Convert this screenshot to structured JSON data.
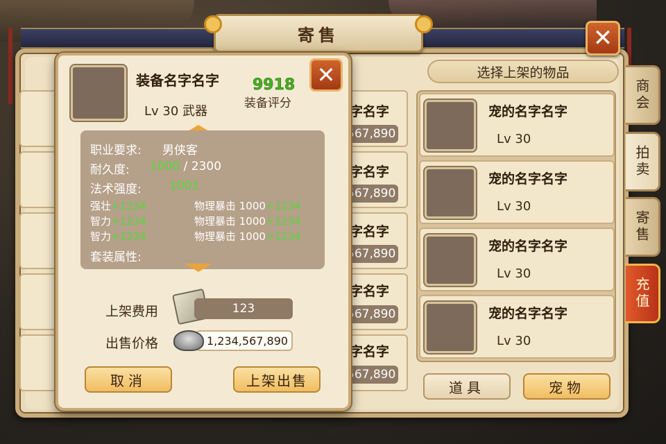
{
  "title": "寄售",
  "close_glyph": "✕",
  "side_tabs": [
    "商会",
    "拍卖",
    "寄售",
    "充值"
  ],
  "select_header": "选择上架的物品",
  "pet_rows": [
    {
      "name": "宠的名字名字",
      "level": "Lv  30"
    },
    {
      "name": "宠的名字名字",
      "level": "Lv  30"
    },
    {
      "name": "宠的名字名字",
      "level": "Lv  30"
    },
    {
      "name": "宠的名字名字",
      "level": "Lv  30"
    }
  ],
  "bottom_tabs": {
    "items": "道具",
    "pets": "宠物"
  },
  "middle_rows": [
    {
      "name_fragment": "字名字",
      "price_fragment": "567,890"
    },
    {
      "name_fragment": "字名字",
      "price_fragment": "567,890"
    },
    {
      "name_fragment": "字名字",
      "price_fragment": "567,890"
    },
    {
      "name_fragment": "字名字",
      "price_fragment": "567,890"
    },
    {
      "name_fragment": "字名字",
      "price_fragment": "567,890"
    }
  ],
  "popup": {
    "item_name": "装备名字名字",
    "level_line": "Lv  30   武器",
    "score_value": "9918",
    "score_label": "装备评分",
    "profession_label": "职业要求:",
    "profession_value": "男侠客",
    "durability_label": "耐久度:",
    "durability_current": "1000",
    "durability_max": " / 2300",
    "spell_label": "法术强度:",
    "spell_value": "1001",
    "stats_left": [
      {
        "name": "强壮",
        "bonus": "+1234"
      },
      {
        "name": "智力",
        "bonus": "+1234"
      },
      {
        "name": "智力",
        "bonus": "+1234"
      }
    ],
    "stats_right": [
      {
        "name": "物理暴击 1000",
        "bonus": "+1234"
      },
      {
        "name": "物理暴击 1000",
        "bonus": "+1234"
      },
      {
        "name": "物理暴击 1000",
        "bonus": "+1234"
      }
    ],
    "set_label": "套装属性:",
    "fee_label": "上架费用",
    "fee_value": "123",
    "price_label": "出售价格",
    "price_value": "1,234,567,890",
    "cancel_label": "取消",
    "confirm_label": "上架出售"
  },
  "colors": {
    "accent_green": "#55d83a",
    "close_red": "#b8441c",
    "recharge_red": "#c8401e"
  }
}
